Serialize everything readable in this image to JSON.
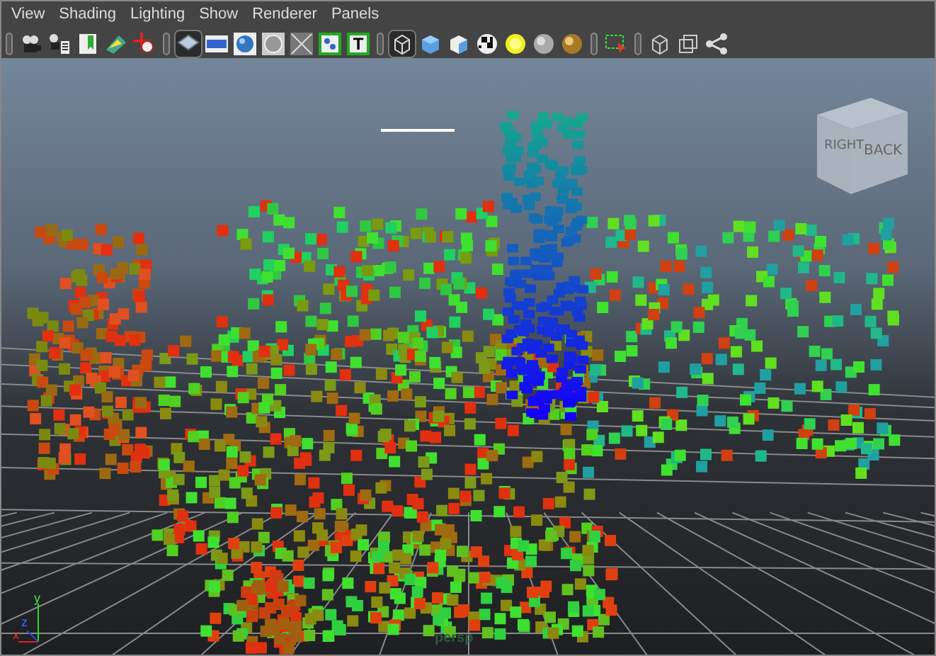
{
  "menu": [
    "View",
    "Shading",
    "Lighting",
    "Show",
    "Renderer",
    "Panels"
  ],
  "toolbar_buttons": [
    {
      "kind": "camera",
      "selected": false
    },
    {
      "kind": "camera-attributes",
      "selected": false
    },
    {
      "kind": "bookmark",
      "selected": false
    },
    {
      "kind": "image-plane",
      "selected": false
    },
    {
      "kind": "crosshair",
      "selected": false
    },
    {
      "kind": "separator"
    },
    {
      "kind": "grid",
      "selected": true
    },
    {
      "kind": "film",
      "selected": false
    },
    {
      "kind": "sphere",
      "selected": false
    },
    {
      "kind": "ring",
      "selected": false
    },
    {
      "kind": "xray",
      "selected": false
    },
    {
      "kind": "dots",
      "selected": false
    },
    {
      "kind": "text",
      "selected": false
    },
    {
      "kind": "separator"
    },
    {
      "kind": "wire-cube",
      "selected": true
    },
    {
      "kind": "solid-cube",
      "selected": false
    },
    {
      "kind": "lit-cube",
      "selected": false
    },
    {
      "kind": "checker",
      "selected": false
    },
    {
      "kind": "light",
      "selected": false
    },
    {
      "kind": "gray-ball",
      "selected": false
    },
    {
      "kind": "gold-ball",
      "selected": false
    },
    {
      "kind": "separator"
    },
    {
      "kind": "marquee",
      "selected": false
    },
    {
      "kind": "separator"
    },
    {
      "kind": "dark-cube",
      "selected": false
    },
    {
      "kind": "squares",
      "selected": false
    },
    {
      "kind": "nodes",
      "selected": false
    }
  ],
  "toolbar_text_glyph": "T",
  "view_cube": {
    "left_face": "RIGHT",
    "right_face": "BACK"
  },
  "axes": {
    "x": "x",
    "y": "y",
    "z": "z"
  },
  "camera_label": "persp"
}
